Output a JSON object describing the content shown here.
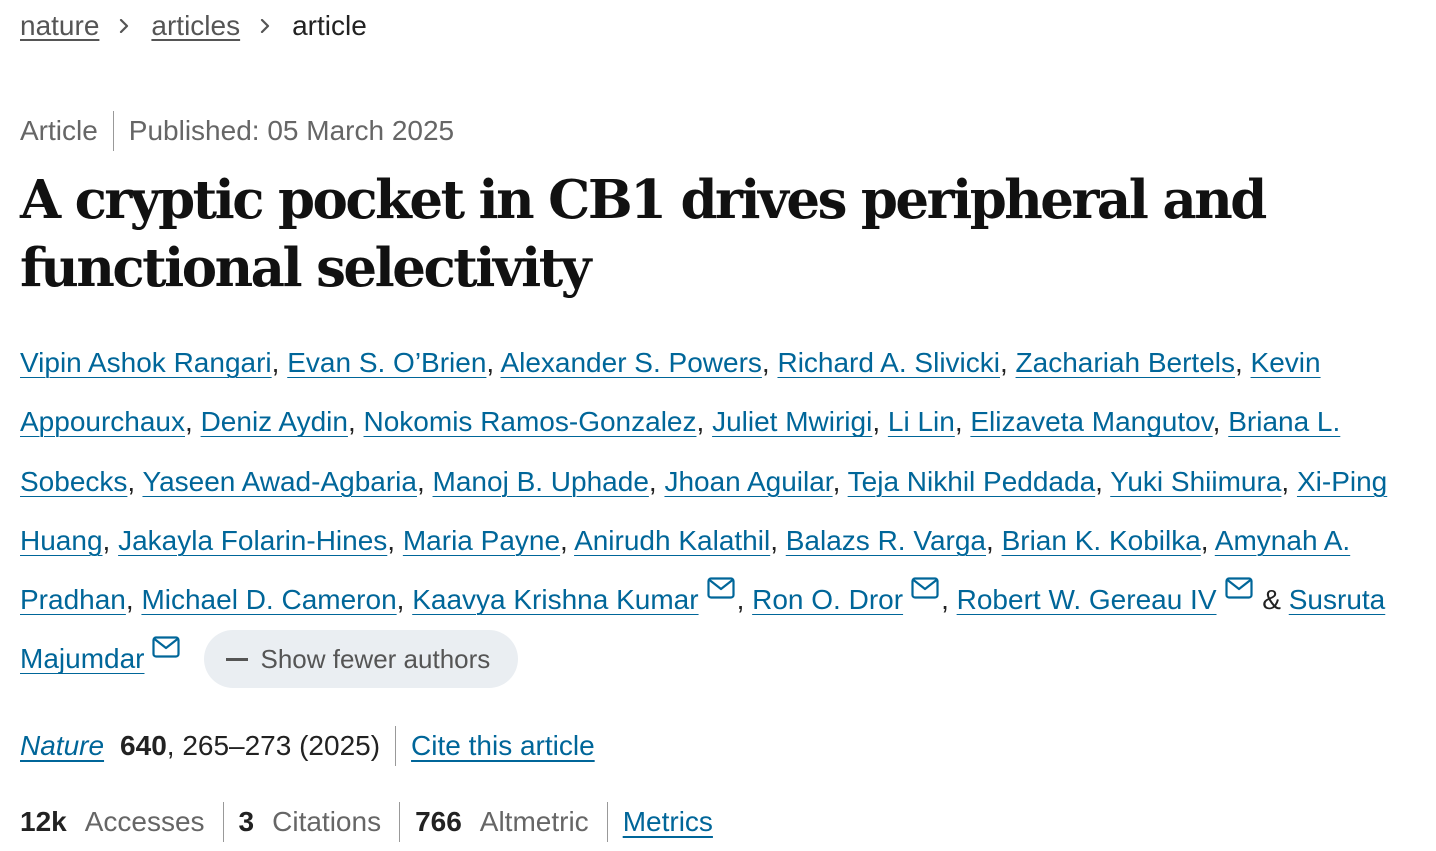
{
  "breadcrumb": {
    "items": [
      {
        "label": "nature",
        "link": true
      },
      {
        "label": "articles",
        "link": true
      },
      {
        "label": "article",
        "link": false
      }
    ]
  },
  "meta": {
    "type": "Article",
    "published": "Published: 05 March 2025"
  },
  "title": "A cryptic pocket in CB1 drives peripheral and functional selectivity",
  "authors": [
    {
      "name": "Vipin Ashok Rangari",
      "sep": ", ",
      "email": false
    },
    {
      "name": "Evan S. O’Brien",
      "sep": ", ",
      "email": false
    },
    {
      "name": "Alexander S. Powers",
      "sep": ", ",
      "email": false
    },
    {
      "name": "Richard A. Slivicki",
      "sep": ", ",
      "email": false
    },
    {
      "name": "Zachariah Bertels",
      "sep": ", ",
      "email": false
    },
    {
      "name": "Kevin Appourchaux",
      "sep": ", ",
      "email": false
    },
    {
      "name": "Deniz Aydin",
      "sep": ", ",
      "email": false
    },
    {
      "name": "Nokomis Ramos-Gonzalez",
      "sep": ", ",
      "email": false
    },
    {
      "name": "Juliet Mwirigi",
      "sep": ", ",
      "email": false
    },
    {
      "name": "Li Lin",
      "sep": ", ",
      "email": false
    },
    {
      "name": "Elizaveta Mangutov",
      "sep": ", ",
      "email": false
    },
    {
      "name": "Briana L. Sobecks",
      "sep": ", ",
      "email": false
    },
    {
      "name": "Yaseen Awad-Agbaria",
      "sep": ", ",
      "email": false
    },
    {
      "name": "Manoj B. Uphade",
      "sep": ", ",
      "email": false
    },
    {
      "name": "Jhoan Aguilar",
      "sep": ", ",
      "email": false
    },
    {
      "name": "Teja Nikhil Peddada",
      "sep": ", ",
      "email": false
    },
    {
      "name": "Yuki Shiimura",
      "sep": ", ",
      "email": false
    },
    {
      "name": "Xi-Ping Huang",
      "sep": ", ",
      "email": false
    },
    {
      "name": "Jakayla Folarin-Hines",
      "sep": ", ",
      "email": false
    },
    {
      "name": "Maria Payne",
      "sep": ", ",
      "email": false
    },
    {
      "name": "Anirudh Kalathil",
      "sep": ", ",
      "email": false
    },
    {
      "name": "Balazs R. Varga",
      "sep": ", ",
      "email": false
    },
    {
      "name": "Brian K. Kobilka",
      "sep": ", ",
      "email": false
    },
    {
      "name": "Amynah A. Pradhan",
      "sep": ", ",
      "email": false
    },
    {
      "name": "Michael D. Cameron",
      "sep": ", ",
      "email": false
    },
    {
      "name": "Kaavya Krishna Kumar",
      "sep": ", ",
      "email": true
    },
    {
      "name": "Ron O. Dror",
      "sep": ", ",
      "email": true
    },
    {
      "name": "Robert W. Gereau IV",
      "sep": " & ",
      "email": true
    },
    {
      "name": "Susruta Majumdar",
      "sep": "",
      "email": true
    }
  ],
  "show_fewer_label": "Show fewer authors",
  "citation": {
    "journal": "Nature",
    "volume": "640",
    "pages": ", 265–273 (2025)",
    "cite_label": "Cite this article"
  },
  "metrics": {
    "accesses_value": "12k",
    "accesses_label": "Accesses",
    "citations_value": "3",
    "citations_label": "Citations",
    "altmetric_value": "766",
    "altmetric_label": "Altmetric",
    "metrics_link": "Metrics"
  },
  "colors": {
    "link": "#006699",
    "muted": "#666666",
    "pill_bg": "#eaeef2"
  },
  "icons": {
    "email": "envelope-icon",
    "breadcrumb_sep": "chevron-right-icon",
    "collapse": "minus-icon"
  }
}
